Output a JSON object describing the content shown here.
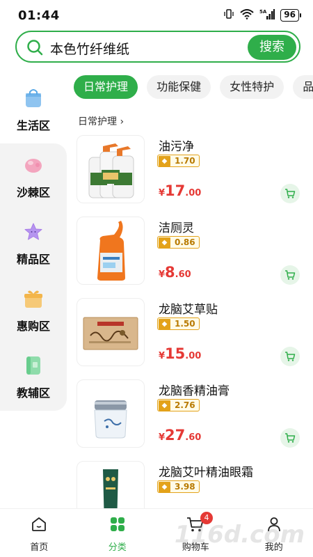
{
  "status": {
    "time": "01:44",
    "battery": "96",
    "network": "5A"
  },
  "search": {
    "query": "本色竹纤维纸",
    "button": "搜索"
  },
  "sidebar": {
    "items": [
      {
        "label": "生活区",
        "icon": "bag-icon",
        "color": "#5aa9e6"
      },
      {
        "label": "沙棘区",
        "icon": "fruit-icon",
        "color": "#f07aa0"
      },
      {
        "label": "精品区",
        "icon": "star-icon",
        "color": "#a97ce8"
      },
      {
        "label": "惠购区",
        "icon": "gift-icon",
        "color": "#f3b54a"
      },
      {
        "label": "教辅区",
        "icon": "book-icon",
        "color": "#4fc37a"
      }
    ]
  },
  "tabs": [
    "日常护理",
    "功能保健",
    "女性特护",
    "品"
  ],
  "breadcrumb": "日常护理 ›",
  "products": [
    {
      "name": "油污净",
      "tag": "1.70",
      "price_int": "17",
      "price_dec": ".00",
      "currency": "¥"
    },
    {
      "name": "洁厕灵",
      "tag": "0.86",
      "price_int": "8",
      "price_dec": ".60",
      "currency": "¥"
    },
    {
      "name": "龙脑艾草贴",
      "tag": "1.50",
      "price_int": "15",
      "price_dec": ".00",
      "currency": "¥"
    },
    {
      "name": "龙脑香精油膏",
      "tag": "2.76",
      "price_int": "27",
      "price_dec": ".60",
      "currency": "¥"
    },
    {
      "name": "龙脑艾叶精油眼霜",
      "tag": "3.98",
      "price_int": "",
      "price_dec": "",
      "currency": ""
    }
  ],
  "bottom_nav": [
    {
      "label": "首页"
    },
    {
      "label": "分类"
    },
    {
      "label": "购物车",
      "badge": "4"
    },
    {
      "label": "我的"
    }
  ],
  "watermark": "116d.com",
  "colors": {
    "accent": "#2fae4a",
    "price": "#e53935",
    "tag": "#e3a21a"
  }
}
